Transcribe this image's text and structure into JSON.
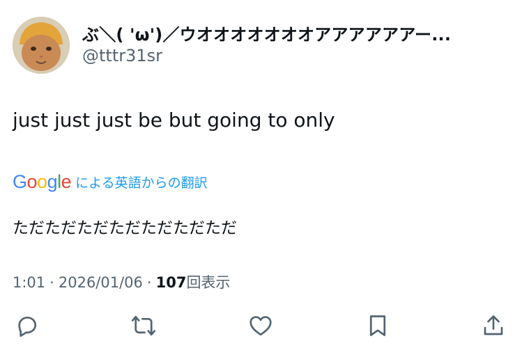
{
  "user": {
    "display_name": "ぶ＼( 'ω')／ウオオオオオオオアアアアアアー...",
    "handle": "@tttr31sr"
  },
  "tweet": {
    "text": "just just just be but going to only"
  },
  "translation": {
    "provider_letters": [
      "G",
      "o",
      "o",
      "g",
      "l",
      "e"
    ],
    "provider_colors": [
      "#4285F4",
      "#EA4335",
      "#FBBC05",
      "#4285F4",
      "#34A853",
      "#EA4335"
    ],
    "label": "による英語からの翻訳",
    "text": "ただただただただただただただ"
  },
  "meta": {
    "time": "1:01",
    "separator": "·",
    "date": "2026/01/06",
    "views_count": "107",
    "views_label": "回表示"
  },
  "actions": {
    "icons": [
      "reply-icon",
      "retweet-icon",
      "like-icon",
      "bookmark-icon",
      "share-icon"
    ]
  }
}
